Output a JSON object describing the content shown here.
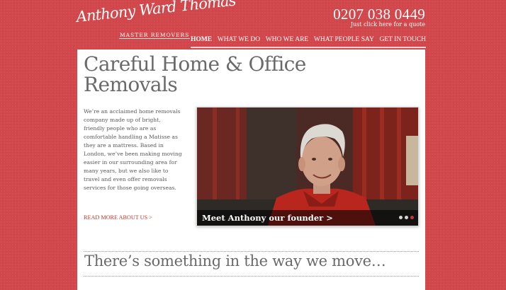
{
  "brand": {
    "name": "Anthony Ward Thomas",
    "tagline": "MASTER REMOVERS"
  },
  "header": {
    "phone": "0207 038 0449",
    "quote_link": "Just click here for a quote"
  },
  "nav": {
    "items": [
      {
        "label": "HOME",
        "active": true
      },
      {
        "label": "WHAT WE DO",
        "active": false
      },
      {
        "label": "WHO WE ARE",
        "active": false
      },
      {
        "label": "WHAT PEOPLE SAY",
        "active": false
      },
      {
        "label": "GET IN TOUCH",
        "active": false
      }
    ]
  },
  "main": {
    "headline_line1": "Careful Home & Office",
    "headline_line2": "Removals",
    "intro": "We’re an acclaimed home removals company made up of bright, friendly people who are as comfortable handling a Matisse as they are a mattress. Based in London, we’ve been making moving easier in our surrounding area for many years, but we also like to travel and even offer removals services for those going overseas.",
    "read_more": "READ MORE ABOUT US >",
    "feature": {
      "caption": "Meet Anthony our founder  >",
      "slides": 3,
      "active_slide": 3
    },
    "tagline": "There’s something in the way we move…"
  },
  "colors": {
    "background": "#d2474b",
    "accent": "#c0392b",
    "heading": "#6a6a6a"
  }
}
